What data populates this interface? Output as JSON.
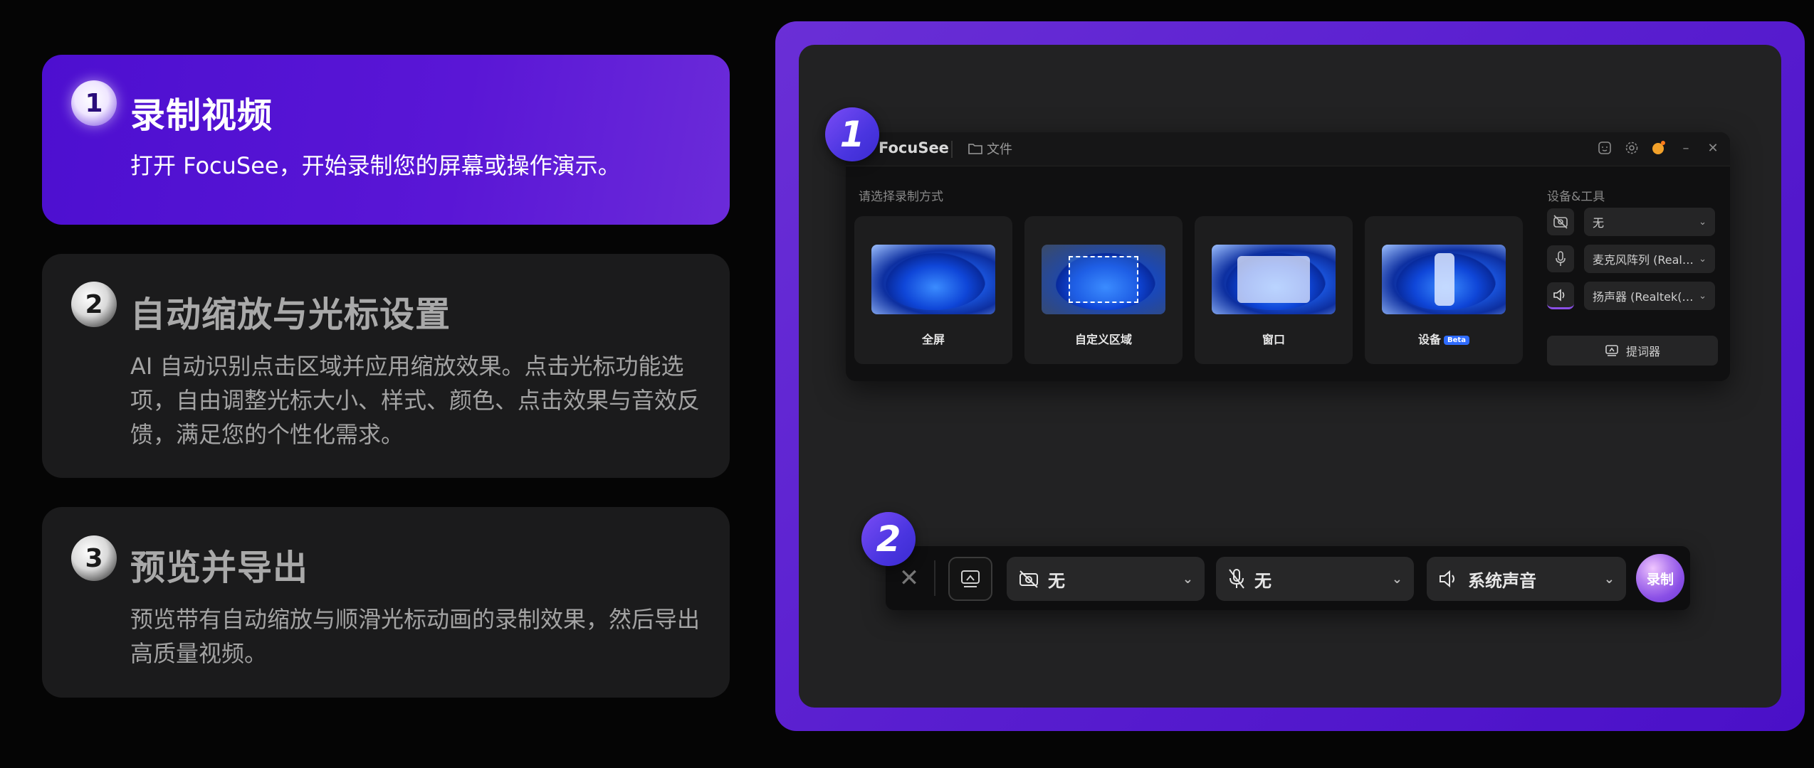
{
  "steps": [
    {
      "num": "1",
      "title": "录制视频",
      "desc": "打开 FocuSee，开始录制您的屏幕或操作演示。"
    },
    {
      "num": "2",
      "title": "自动缩放与光标设置",
      "desc": "AI 自动识别点击区域并应用缩放效果。点击光标功能选项，自由调整光标大小、样式、颜色、点击效果与音效反馈，满足您的个性化需求。"
    },
    {
      "num": "3",
      "title": "预览并导出",
      "desc": "预览带有自动缩放与顺滑光标动画的录制效果，然后导出高质量视频。"
    }
  ],
  "badges": {
    "one": "1",
    "two": "2"
  },
  "app": {
    "name": "FocuSee",
    "file_menu": "文件",
    "mode_label": "请选择录制方式",
    "tools_label": "设备&工具",
    "modes": [
      {
        "name": "全屏"
      },
      {
        "name": "自定义区域"
      },
      {
        "name": "窗口"
      },
      {
        "name": "设备",
        "badge": "Beta"
      }
    ],
    "tools": [
      {
        "icon": "camera-off-icon",
        "value": "无"
      },
      {
        "icon": "microphone-icon",
        "value": "麦克风阵列 (Realtek(R) Audio)"
      },
      {
        "icon": "speaker-icon",
        "value": "扬声器 (Realtek(R) Audio)"
      }
    ],
    "prompter": "提词器"
  },
  "toolbar": {
    "camera": "无",
    "mic": "无",
    "audio": "系统声音",
    "record": "录制"
  },
  "colors": {
    "accent": "#5a16d6",
    "frame": "#5a1fd0",
    "card": "#1b1b1c"
  }
}
